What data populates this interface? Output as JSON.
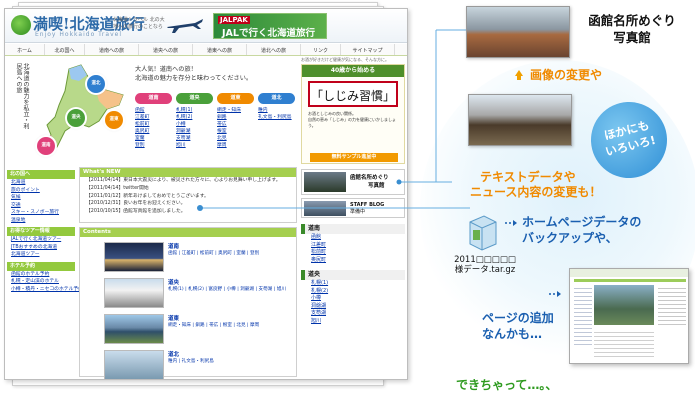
{
  "site": {
    "logo_title": "満喫!北海道旅行",
    "logo_sub": "Enjoy Hokkaido Travel",
    "tagline": "北海道トラベル 北の大地への旅行のことなら",
    "jal_logo": "JALPAK",
    "jal_banner": "JALで行く北海道旅行"
  },
  "nav": [
    "ホーム",
    "北の国へ",
    "道南への旅",
    "道央への旅",
    "道東への旅",
    "道北への旅",
    "リンク",
    "サイトマップ"
  ],
  "map": {
    "vertical_text": "北海道の魅力を私立・利尻島への旅",
    "bubbles": [
      "道南",
      "道央",
      "道東",
      "道北"
    ],
    "welcome_lines": [
      "大人気！道南への旅！",
      "北海道の魅力を存分と味わってください。"
    ]
  },
  "regions": [
    {
      "name": "道南",
      "color": "#e0407a",
      "links": [
        "函館",
        "江差町",
        "松前町",
        "奥尻町",
        "室蘭",
        "登別"
      ]
    },
    {
      "name": "道央",
      "color": "#4aa03a",
      "links": [
        "札幌(1)",
        "札幌(2)",
        "小樽",
        "洞爺湖",
        "支笏湖",
        "旭川"
      ]
    },
    {
      "name": "道東",
      "color": "#f08a00",
      "links": [
        "網走・知床",
        "釧路",
        "帯広",
        "根室",
        "北見",
        "摩周"
      ]
    },
    {
      "name": "道北",
      "color": "#2f7fd0",
      "links": [
        "稚内",
        "礼文島・利尻島"
      ]
    }
  ],
  "right_col": {
    "ad_note": "お酒が好きだけど健康が気になる、そんな方に。",
    "ad_bar": "40歳から始める",
    "ad_title": "「しじみ習慣」",
    "ad_lines": [
      "お酒としじみの良い関係。",
      "自然の恵み「しじみ」の力を健康にいかしましょう。"
    ],
    "ad_sample": "無料サンプル進呈中",
    "thumb_label": [
      "函館名所めぐり",
      "写真館"
    ],
    "staff_label": [
      "STAFF BLOG",
      "準備中"
    ],
    "sections": [
      {
        "title": "道南",
        "links": [
          "函館",
          "江差町",
          "松前町",
          "奥尻町"
        ]
      },
      {
        "title": "道央",
        "links": [
          "札幌(1)",
          "札幌(2)",
          "小樽",
          "洞爺湖",
          "支笏湖",
          "旭川"
        ]
      }
    ]
  },
  "left_side": {
    "sections": [
      {
        "title": "北の国へ",
        "links": [
          "北海道",
          "旅のポイント",
          "気候",
          "交通",
          "スキー・スノボー旅行",
          "温泉地"
        ]
      },
      {
        "title": "お得なツアー情報",
        "links": [
          "JALで行く北海道ツアー",
          "JTBおすすめの北海道",
          "北海道ツアー"
        ]
      },
      {
        "title": "ホテル予約",
        "links": [
          "函館のホテル予約",
          "札幌・定山渓のホテル",
          "小樽・積丹・ニセコのホテル予約"
        ]
      }
    ]
  },
  "news": {
    "title": "What's NEW",
    "items": [
      "【2011/04/14】東日本大震災により、被災された方々に、心よりお見舞い申し上げます。",
      "【2011/04/14】twitter開始",
      "【2011/01/12】新年あけましておめでとうございます。",
      "【2010/12/31】良いお年をお迎えください。",
      "【2010/10/15】函館写真館を追加しました。"
    ]
  },
  "contents": {
    "title": "Contents",
    "rows": [
      {
        "title": "道南",
        "links": "函館 | 江差町 | 松前町 | 奥尻町 | 室蘭 | 登別"
      },
      {
        "title": "道央",
        "links": "札幌(1) | 札幌(2) | 富良野 | 小樽 | 洞爺湖 | 支笏湖 | 旭川"
      },
      {
        "title": "道東",
        "links": "網走・知床 | 釧路 | 帯広 | 根室 | 北見 | 摩周"
      },
      {
        "title": "道北",
        "links": "稚内 | 礼文島・利尻島"
      }
    ]
  },
  "callouts": {
    "photo_label": [
      "函館名所めぐり",
      "写真館"
    ],
    "image_change": "画像の変更や",
    "text_change": [
      "テキストデータや",
      "ニュース内容の変更も！"
    ],
    "bubble": [
      "ほかにも",
      "いろいろ!"
    ],
    "backup": [
      "ホームページデータの",
      "バックアップや、"
    ],
    "archive_label": [
      "2011□□□□□",
      "様データ.tar.gz"
    ],
    "add_page": [
      "ページの追加",
      "なんかも…"
    ],
    "done": "できちゃって…。、"
  },
  "colors": {
    "orange": "#f08a00",
    "blue": "#1a5fb0",
    "green": "#2d9a1e",
    "accent_green": "#a5cf4f"
  }
}
